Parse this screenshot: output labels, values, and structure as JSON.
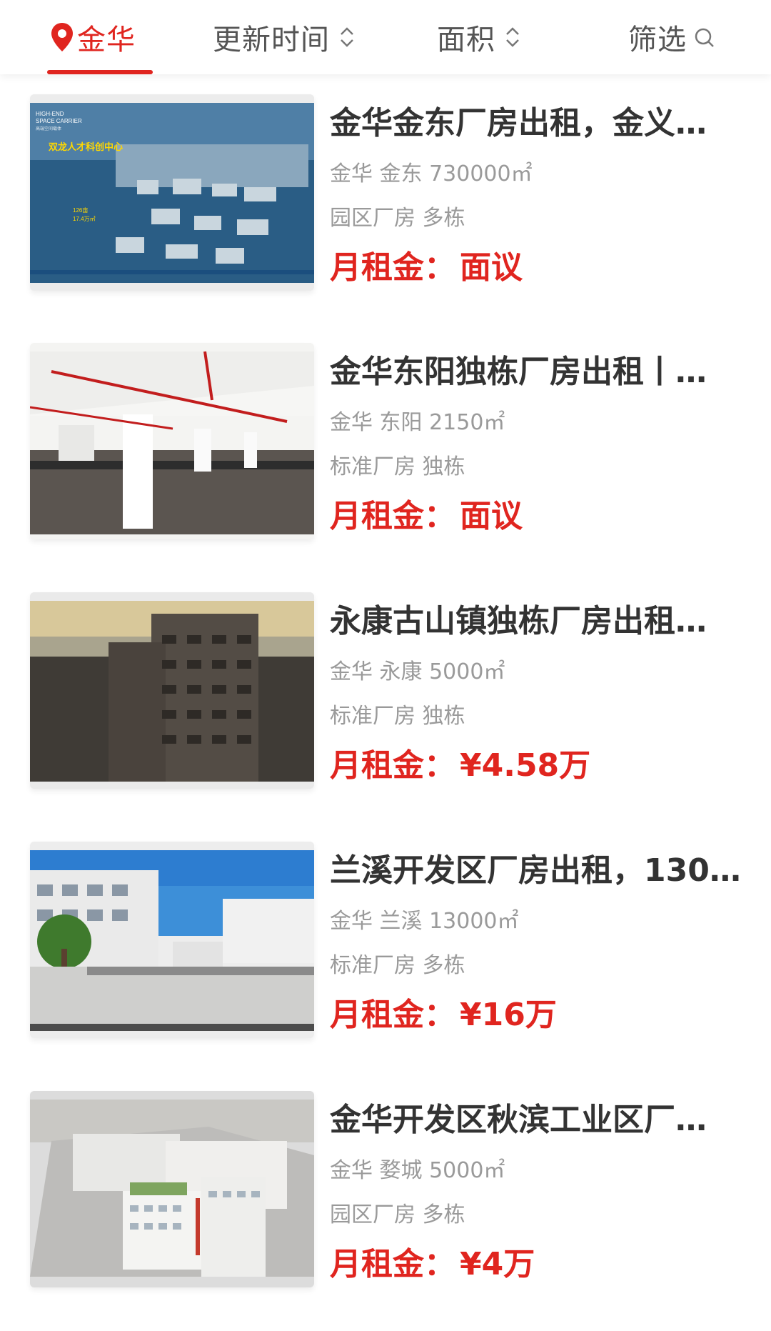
{
  "tabs": {
    "city": "金华",
    "update_time": "更新时间",
    "area": "面积",
    "filter": "筛选"
  },
  "accent_color": "#e0251f",
  "listings": [
    {
      "title": "金华金东厂房出租，金义…",
      "location": "金华 金东 730000㎡",
      "tags": "园区厂房 多栋",
      "price_label": "月租金：",
      "price": "面议",
      "image_text": {
        "line1": "HIGH-END",
        "line2": "SPACE CARRIER",
        "line3": "高端空间载体",
        "banner": "双龙人才科创中心",
        "stat1": "126亩",
        "stat2": "17.4万㎡"
      }
    },
    {
      "title": "金华东阳独栋厂房出租丨…",
      "location": "金华 东阳 2150㎡",
      "tags": "标准厂房 独栋",
      "price_label": "月租金：",
      "price": "面议"
    },
    {
      "title": "永康古山镇独栋厂房出租…",
      "location": "金华 永康 5000㎡",
      "tags": "标准厂房 独栋",
      "price_label": "月租金：",
      "price": "¥4.58万"
    },
    {
      "title": "兰溪开发区厂房出租，130…",
      "location": "金华 兰溪 13000㎡",
      "tags": "标准厂房 多栋",
      "price_label": "月租金：",
      "price": "¥16万"
    },
    {
      "title": "金华开发区秋滨工业区厂…",
      "location": "金华 婺城 5000㎡",
      "tags": "园区厂房 多栋",
      "price_label": "月租金：",
      "price": "¥4万"
    }
  ]
}
